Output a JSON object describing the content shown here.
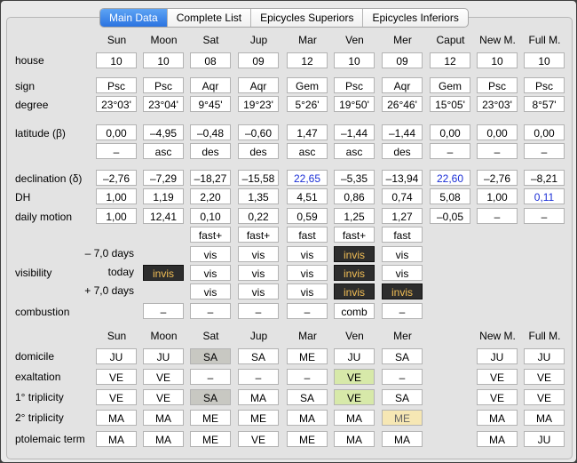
{
  "tabs": [
    "Main Data",
    "Complete List",
    "Epicycles Superiors",
    "Epicycles Inferiors"
  ],
  "columns": [
    "Sun",
    "Moon",
    "Sat",
    "Jup",
    "Mar",
    "Ven",
    "Mer",
    "Caput",
    "New M.",
    "Full M."
  ],
  "rows": {
    "house": {
      "label": "house",
      "values": [
        "10",
        "10",
        "08",
        "09",
        "12",
        "10",
        "09",
        "12",
        "10",
        "10"
      ]
    },
    "sign": {
      "label": "sign",
      "values": [
        "Psc",
        "Psc",
        "Aqr",
        "Aqr",
        "Gem",
        "Psc",
        "Aqr",
        "Gem",
        "Psc",
        "Psc"
      ]
    },
    "degree": {
      "label": "degree",
      "values": [
        "23°03'",
        "23°04'",
        "9°45'",
        "19°23'",
        "5°26'",
        "19°50'",
        "26°46'",
        "15°05'",
        "23°03'",
        "8°57'"
      ]
    },
    "latitude": {
      "label": "latitude (β)",
      "values": [
        "0,00",
        "–4,95",
        "–0,48",
        "–0,60",
        "1,47",
        "–1,44",
        "–1,44",
        "0,00",
        "0,00",
        "0,00"
      ]
    },
    "latitude_dir": {
      "values": [
        "–",
        "asc",
        "des",
        "des",
        "asc",
        "asc",
        "des",
        "–",
        "–",
        "–"
      ]
    },
    "declination": {
      "label": "declination (δ)",
      "values": [
        "–2,76",
        "–7,29",
        "–18,27",
        "–15,58",
        "22,65",
        "–5,35",
        "–13,94",
        "22,60",
        "–2,76",
        "–8,21"
      ]
    },
    "dh": {
      "label": "DH",
      "values": [
        "1,00",
        "1,19",
        "2,20",
        "1,35",
        "4,51",
        "0,86",
        "0,74",
        "5,08",
        "1,00",
        "0,11"
      ]
    },
    "daily_motion": {
      "label": "daily motion",
      "values": [
        "1,00",
        "12,41",
        "0,10",
        "0,22",
        "0,59",
        "1,25",
        "1,27",
        "–0,05",
        "–",
        "–"
      ]
    },
    "speed": {
      "values": [
        "fast+",
        "fast+",
        "fast",
        "fast+",
        "fast"
      ]
    },
    "visibility": {
      "label": "visibility",
      "minus_label": "– 7,0 days",
      "today_label": "today",
      "plus_label": "+ 7,0 days",
      "minus": [
        "vis",
        "vis",
        "vis",
        "invis",
        "vis"
      ],
      "today": [
        "invis",
        "vis",
        "vis",
        "vis",
        "invis",
        "vis"
      ],
      "plus": [
        "vis",
        "vis",
        "vis",
        "invis",
        "invis"
      ]
    },
    "combustion": {
      "label": "combustion",
      "values": [
        "–",
        "–",
        "–",
        "–",
        "comb",
        "–"
      ]
    }
  },
  "dignity_columns": [
    "Sun",
    "Moon",
    "Sat",
    "Jup",
    "Mar",
    "Ven",
    "Mer",
    "New M.",
    "Full M."
  ],
  "dignities": {
    "domicile": {
      "label": "domicile",
      "values": [
        "JU",
        "JU",
        "SA",
        "SA",
        "ME",
        "JU",
        "SA",
        "JU",
        "JU"
      ]
    },
    "exaltation": {
      "label": "exaltation",
      "values": [
        "VE",
        "VE",
        "–",
        "–",
        "–",
        "VE",
        "–",
        "VE",
        "VE"
      ]
    },
    "triplicity1": {
      "label": "1° triplicity",
      "values": [
        "VE",
        "VE",
        "SA",
        "MA",
        "SA",
        "VE",
        "SA",
        "VE",
        "VE"
      ]
    },
    "triplicity2": {
      "label": "2° triplicity",
      "values": [
        "MA",
        "MA",
        "ME",
        "ME",
        "MA",
        "MA",
        "ME",
        "MA",
        "MA"
      ]
    },
    "ptolemaic": {
      "label": "ptolemaic term",
      "values": [
        "MA",
        "MA",
        "ME",
        "VE",
        "ME",
        "MA",
        "MA",
        "MA",
        "JU"
      ]
    }
  },
  "colors": {
    "blue_value": "#1b2fd6",
    "invis_bg": "#2d2d2d",
    "invis_text": "#f2be55",
    "highlight_gray": "#c8c8c2",
    "highlight_green": "#d7e9a9",
    "highlight_cream": "#f6e7b4",
    "tab_active": "#2b73e0"
  }
}
